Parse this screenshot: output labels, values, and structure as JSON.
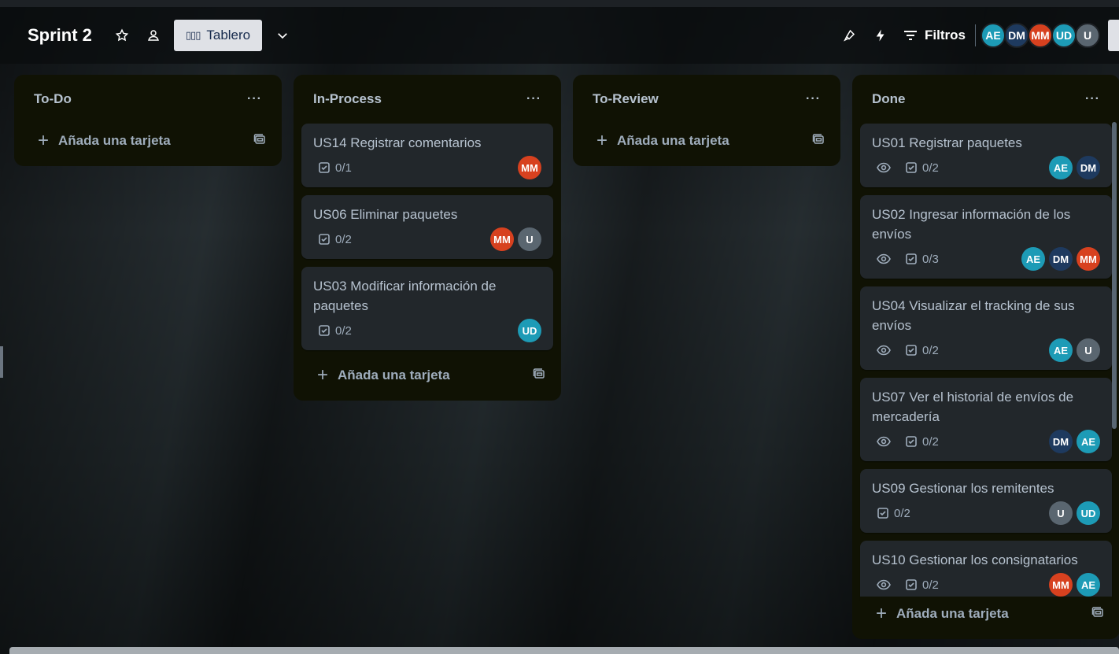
{
  "header": {
    "board_title": "Sprint 2",
    "view_label": "Tablero",
    "view_icon": "board-bars-icon",
    "filters_label": "Filtros",
    "avatars": [
      {
        "initials": "AE",
        "color": "#1d9bb6"
      },
      {
        "initials": "DM",
        "color": "#1e3a5f"
      },
      {
        "initials": "MM",
        "color": "#d7411f"
      },
      {
        "initials": "UD",
        "color": "#1d9bb6"
      },
      {
        "initials": "U",
        "color": "#5a6670"
      }
    ]
  },
  "colors": {
    "AE": "#1d9bb6",
    "DM": "#1e3a5f",
    "MM": "#d7411f",
    "UD": "#1d9bb6",
    "U": "#5a6670"
  },
  "lists": [
    {
      "title": "To-Do",
      "menu": "···",
      "add_label": "Añada una tarjeta",
      "cards": []
    },
    {
      "title": "In-Process",
      "menu": "···",
      "add_label": "Añada una tarjeta",
      "cards": [
        {
          "title": "US14 Registrar comentarios",
          "watch": false,
          "checklist": "0/1",
          "members": [
            "MM"
          ]
        },
        {
          "title": "US06 Eliminar paquetes",
          "watch": false,
          "checklist": "0/2",
          "members": [
            "MM",
            "U"
          ]
        },
        {
          "title": "US03 Modificar información de paquetes",
          "watch": false,
          "checklist": "0/2",
          "members": [
            "UD"
          ]
        }
      ]
    },
    {
      "title": "To-Review",
      "menu": "···",
      "add_label": "Añada una tarjeta",
      "cards": []
    },
    {
      "title": "Done",
      "menu": "···",
      "add_label": "Añada una tarjeta",
      "cards": [
        {
          "title": "US01 Registrar paquetes",
          "watch": true,
          "checklist": "0/2",
          "members": [
            "AE",
            "DM"
          ]
        },
        {
          "title": "US02 Ingresar información de los envíos",
          "watch": true,
          "checklist": "0/3",
          "members": [
            "AE",
            "DM",
            "MM"
          ]
        },
        {
          "title": "US04 Visualizar el tracking de sus envíos",
          "watch": true,
          "checklist": "0/2",
          "members": [
            "AE",
            "U"
          ]
        },
        {
          "title": "US07 Ver el historial de envíos de mercadería",
          "watch": true,
          "checklist": "0/2",
          "members": [
            "DM",
            "AE"
          ]
        },
        {
          "title": "US09 Gestionar los remitentes",
          "watch": false,
          "checklist": "0/2",
          "members": [
            "U",
            "UD"
          ]
        },
        {
          "title": "US10 Gestionar los consignatarios",
          "watch": true,
          "checklist": "0/2",
          "members": [
            "MM",
            "AE"
          ]
        }
      ]
    }
  ]
}
